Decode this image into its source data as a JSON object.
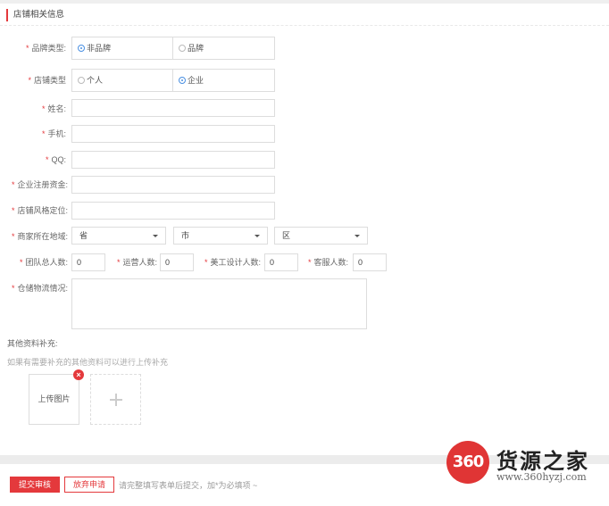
{
  "section": {
    "title": "店铺相关信息"
  },
  "brand_type": {
    "label": "品牌类型:",
    "options": [
      "非品牌",
      "品牌"
    ],
    "selected": "非品牌"
  },
  "shop_type": {
    "label": "店铺类型",
    "options": [
      "个人",
      "企业"
    ],
    "selected": "企业"
  },
  "fields": {
    "name_label": "姓名:",
    "phone_label": "手机:",
    "qq_label": "QQ:",
    "capital_label": "企业注册资金:",
    "style_label": "店铺风格定位:",
    "region_label": "商家所在地域:"
  },
  "region": {
    "province": "省",
    "city": "市",
    "district": "区"
  },
  "staff": {
    "total_label": "团队总人数:",
    "total_value": "0",
    "ops_label": "运营人数:",
    "ops_value": "0",
    "design_label": "美工设计人数:",
    "design_value": "0",
    "service_label": "客服人数:",
    "service_value": "0"
  },
  "logistics": {
    "label": "仓储物流情况:"
  },
  "supplement": {
    "title": "其他资料补充:",
    "hint": "如果有需要补充的其他资料可以进行上传补充",
    "upload_label": "上传图片",
    "delete_glyph": "×",
    "add_glyph": "+"
  },
  "footer": {
    "submit": "提交审核",
    "abandon": "放弃申请",
    "note": "请完整填写表单后提交，加*为必填项 ~"
  },
  "watermark": {
    "badge": "360",
    "title": "货源之家",
    "url": "www.360hyzj.com"
  },
  "colors": {
    "accent": "#e4393c",
    "radio_on": "#4a90e2"
  }
}
